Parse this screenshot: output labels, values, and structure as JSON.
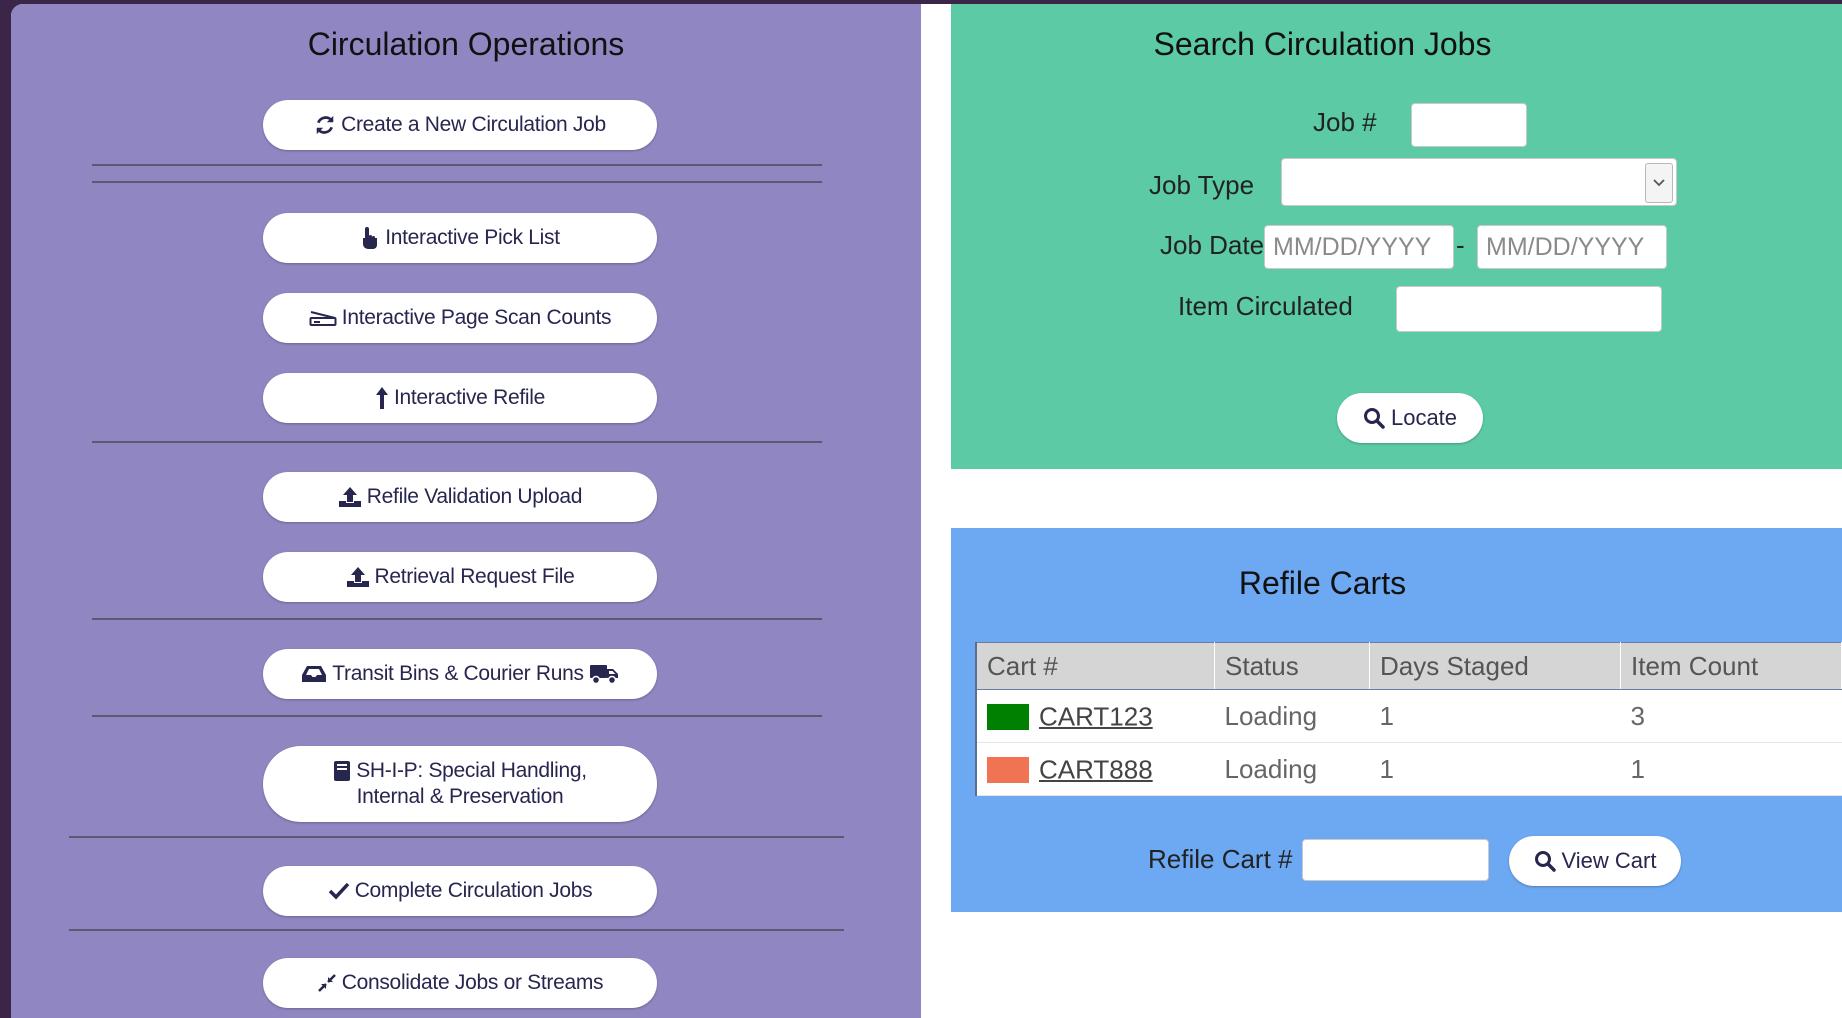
{
  "left": {
    "title": "Circulation Operations",
    "buttons": {
      "create_job": "Create a New Circulation Job",
      "pick_list": "Interactive Pick List",
      "page_scan": "Interactive Page Scan Counts",
      "refile": "Interactive Refile",
      "refile_validation": "Refile Validation Upload",
      "retrieval_request": "Retrieval Request File",
      "transit_bins": "Transit Bins & Courier Runs",
      "ship_line1": "SH-I-P: Special Handling,",
      "ship_line2": "Internal & Preservation",
      "complete_jobs": "Complete Circulation Jobs",
      "consolidate": "Consolidate Jobs or Streams"
    },
    "icons": [
      "refresh-icon",
      "hand-pointer-icon",
      "scanner-icon",
      "arrow-up-icon",
      "upload-icon",
      "upload-icon",
      "inbox-icon",
      "truck-icon",
      "book-icon",
      "check-icon",
      "compress-icon"
    ]
  },
  "search": {
    "title": "Search Circulation Jobs",
    "job_num_label": "Job #",
    "job_num_value": "",
    "job_type_label": "Job Type",
    "job_type_value": "",
    "job_date_label": "Job Date",
    "date_from_placeholder": "MM/DD/YYYY",
    "date_separator": "-",
    "date_to_placeholder": "MM/DD/YYYY",
    "item_label": "Item Circulated",
    "item_value": "",
    "locate_button": "Locate"
  },
  "carts": {
    "title": "Refile Carts",
    "headers": [
      "Cart #",
      "Status",
      "Days Staged",
      "Item Count"
    ],
    "rows": [
      {
        "color": "#008000",
        "cart": "CART123",
        "status": "Loading",
        "days": "1",
        "count": "3"
      },
      {
        "color": "#f07454",
        "cart": "CART888",
        "status": "Loading",
        "days": "1",
        "count": "1"
      }
    ],
    "refile_cart_label": "Refile Cart #",
    "refile_cart_value": "",
    "view_cart_button": "View Cart"
  },
  "colors": {
    "left_panel": "#9086c1",
    "search_panel": "#5bcaa5",
    "carts_panel": "#6da8f3",
    "button_text": "#27264f"
  }
}
